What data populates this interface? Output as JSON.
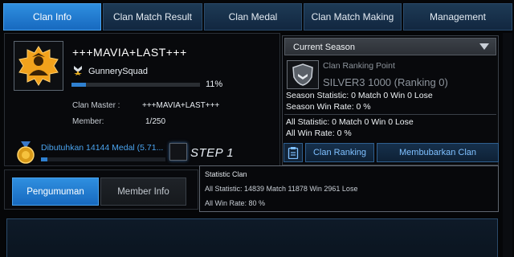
{
  "tabs": [
    {
      "label": "Clan Info",
      "active": true
    },
    {
      "label": "Clan Match Result",
      "active": false
    },
    {
      "label": "Clan Medal",
      "active": false
    },
    {
      "label": "Clan Match Making",
      "active": false
    },
    {
      "label": "Management",
      "active": false
    }
  ],
  "clan": {
    "name": "+++MAVIA+LAST+++",
    "squad": "GunnerySquad",
    "progress_text": "11%",
    "progress_value": 0.11,
    "master_label": "Clan Master :",
    "master_value": "+++MAVIA+LAST+++",
    "member_label": "Member:",
    "member_value": "1/250",
    "medal_text": "Dibutuhkan 14144 Medal (5.71...",
    "medal_progress": 0.05,
    "step_text": "STEP 1"
  },
  "season": {
    "selected": "Current Season",
    "ranking_title": "Clan Ranking Point",
    "ranking_value": "SILVER3 1000 (Ranking 0)",
    "season_statistic": "Season Statistic: 0 Match 0 Win 0 Lose",
    "season_win_rate": "Season Win Rate: 0 %",
    "all_statistic": "All Statistic: 0 Match 0 Win 0 Lose",
    "all_win_rate": "All Win Rate: 0 %"
  },
  "buttons": {
    "clan_ranking": "Clan Ranking",
    "disband": "Membubarkan Clan"
  },
  "tooltip": {
    "title": "Statistic Clan",
    "statistic": "All Statistic: 14839 Match 11878 Win 2961 Lose",
    "win_rate": "All Win Rate: 80 %"
  },
  "lower_tabs": [
    {
      "label": "Pengumuman",
      "active": true
    },
    {
      "label": "Member Info",
      "active": false
    }
  ],
  "colors": {
    "accent": "#1f7fd8",
    "link": "#4aa3ee",
    "emblem": "#f0a020"
  }
}
